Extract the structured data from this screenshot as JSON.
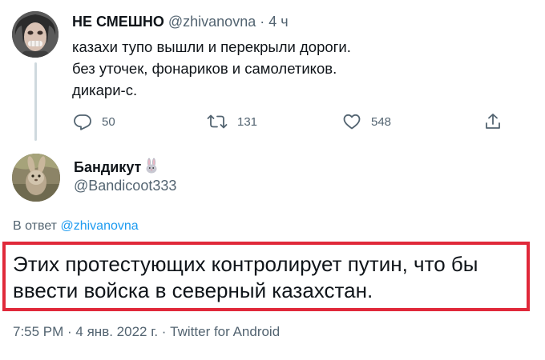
{
  "original_tweet": {
    "display_name": "НЕ СМЕШНО",
    "handle": "@zhivanovna",
    "separator": "·",
    "time_ago": "4 ч",
    "lines": [
      "казахи тупо вышли и перекрыли дороги.",
      "без уточек, фонариков и самолетиков.",
      "дикари-с."
    ],
    "actions": {
      "replies": "50",
      "retweets": "131",
      "likes": "548"
    },
    "icons": [
      "reply-icon",
      "retweet-icon",
      "like-icon",
      "share-icon"
    ]
  },
  "reply_tweet": {
    "display_name": "Бандикут",
    "name_emoji": "rabbit-emoji-icon",
    "handle": "@Bandicoot333",
    "reply_to_prefix": "В ответ",
    "reply_to_handle": "@zhivanovna",
    "lines": [
      "Этих протестующих контролирует путин, что бы",
      "ввести войска в северный казахстан."
    ],
    "timestamp": "7:55 PM · 4 янв. 2022 г. · Twitter for Android"
  },
  "colors": {
    "text_primary": "#0f1419",
    "text_secondary": "#536471",
    "link": "#1d9bf0",
    "highlight_border": "#e0293a",
    "thread_line": "#cfd9de"
  }
}
